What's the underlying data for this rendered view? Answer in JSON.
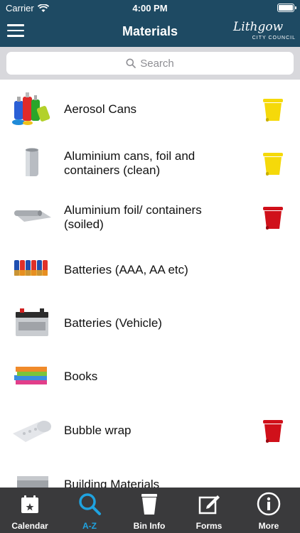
{
  "status_bar": {
    "carrier": "Carrier",
    "time": "4:00 PM"
  },
  "nav": {
    "title": "Materials",
    "logo_script": "Lithgow",
    "logo_council": "CITY COUNCIL"
  },
  "search": {
    "placeholder": "Search"
  },
  "materials": [
    {
      "label": "Aerosol Cans",
      "thumb": "aerosol-cans-image",
      "bin": "yellow-bin"
    },
    {
      "label": "Aluminium cans, foil and containers (clean)",
      "thumb": "aluminium-can-image",
      "bin": "yellow-bin"
    },
    {
      "label": "Aluminium foil/ containers (soiled)",
      "thumb": "foil-roll-image",
      "bin": "red-bin"
    },
    {
      "label": "Batteries (AAA, AA etc)",
      "thumb": "batteries-image",
      "bin": ""
    },
    {
      "label": "Batteries (Vehicle)",
      "thumb": "car-battery-image",
      "bin": ""
    },
    {
      "label": "Books",
      "thumb": "books-image",
      "bin": ""
    },
    {
      "label": "Bubble wrap",
      "thumb": "bubble-wrap-image",
      "bin": "red-bin"
    },
    {
      "label": "Building Materials",
      "thumb": "building-materials-image",
      "bin": ""
    }
  ],
  "tabs": [
    {
      "label": "Calendar",
      "icon": "calendar-icon",
      "active": false
    },
    {
      "label": "A-Z",
      "icon": "search-icon",
      "active": true
    },
    {
      "label": "Bin Info",
      "icon": "bin-icon",
      "active": false
    },
    {
      "label": "Forms",
      "icon": "edit-form-icon",
      "active": false
    },
    {
      "label": "More",
      "icon": "info-icon",
      "active": false
    }
  ],
  "colors": {
    "header": "#1e4a63",
    "search_bg": "#d8d8dc",
    "tab_bar": "#3a3a3c",
    "active_tab": "#1fa3e0",
    "yellow_bin": "#f5d90a",
    "red_bin": "#d0101a"
  }
}
